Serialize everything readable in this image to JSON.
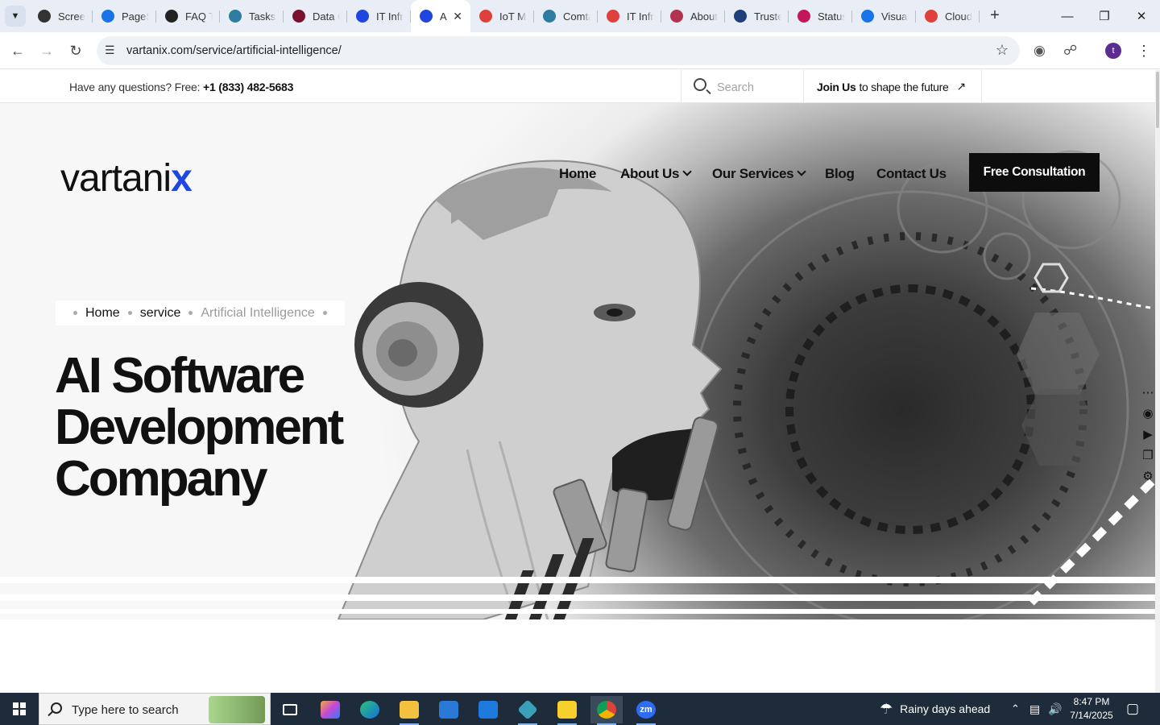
{
  "browser": {
    "tabs": [
      {
        "label": "Screen",
        "icon": "gear-icon",
        "color": "#333333"
      },
      {
        "label": "PageS",
        "icon": "pagespeed-icon",
        "color": "#1a73e8"
      },
      {
        "label": "FAQ T",
        "icon": "faq-icon",
        "color": "#222222"
      },
      {
        "label": "Tasks",
        "icon": "tasks-icon",
        "color": "#2c7da0"
      },
      {
        "label": "Data C",
        "icon": "vee-icon",
        "color": "#7a1030"
      },
      {
        "label": "IT Infr",
        "icon": "check-icon",
        "color": "#1f46e0"
      },
      {
        "label": "A",
        "icon": "vartanix-icon",
        "color": "#1f46e0",
        "active": true
      },
      {
        "label": "IoT M",
        "icon": "tag-icon",
        "color": "#e0403b"
      },
      {
        "label": "Comta",
        "icon": "comta-icon",
        "color": "#2c7da0"
      },
      {
        "label": "IT Infr",
        "icon": "tag-icon",
        "color": "#e0403b"
      },
      {
        "label": "About",
        "icon": "about-icon",
        "color": "#b0344f"
      },
      {
        "label": "Truste",
        "icon": "scales-icon",
        "color": "#1f3f7a"
      },
      {
        "label": "Status",
        "icon": "status-icon",
        "color": "#c2185b"
      },
      {
        "label": "Visual",
        "icon": "pulse-icon",
        "color": "#1a73e8"
      },
      {
        "label": "Cloud",
        "icon": "slash-icon",
        "color": "#e0403b"
      }
    ],
    "url": "vartanix.com/service/artificial-intelligence/",
    "profile_initial": "t"
  },
  "page": {
    "topbar": {
      "question": "Have any questions? Free: ",
      "phone": "+1 (833) 482-5683",
      "search_placeholder": "Search",
      "join_bold": "Join Us",
      "join_rest": "to shape the future"
    },
    "logo": {
      "text": "vartani",
      "accent": "x",
      "accent_color": "#1f46e0"
    },
    "nav": [
      {
        "label": "Home",
        "dropdown": false
      },
      {
        "label": "About Us",
        "dropdown": true
      },
      {
        "label": "Our Services",
        "dropdown": true
      },
      {
        "label": "Blog",
        "dropdown": false
      },
      {
        "label": "Contact Us",
        "dropdown": false
      }
    ],
    "cta": "Free Consultation",
    "breadcrumb": [
      "Home",
      "service",
      "Artificial Intelligence"
    ],
    "heading": [
      "AI Software",
      "Development",
      "Company"
    ]
  },
  "taskbar": {
    "search_placeholder": "Type here to search",
    "weather": "Rainy days ahead",
    "time": "8:47 PM",
    "date": "7/14/2025"
  }
}
